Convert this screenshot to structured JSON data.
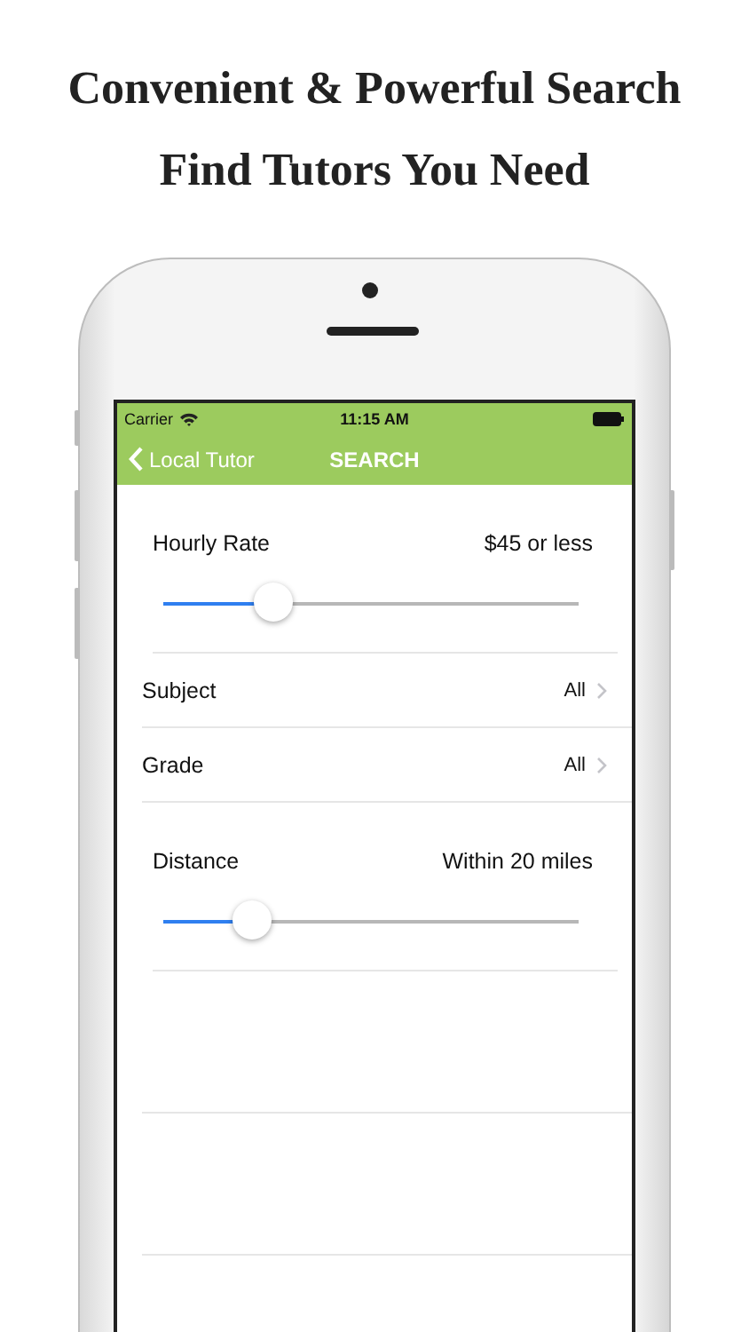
{
  "headline": [
    "Convenient & Powerful Search",
    "Find Tutors You Need"
  ],
  "status_bar": {
    "carrier": "Carrier",
    "time": "11:15 AM"
  },
  "nav_bar": {
    "back": "Local Tutor",
    "title": "SEARCH"
  },
  "rows": [
    {
      "kind": "slider",
      "label": "Hourly Rate",
      "value": "$45 or less",
      "level": 0.27
    },
    {
      "kind": "link",
      "label": "Subject",
      "value": "All"
    },
    {
      "kind": "link",
      "label": "Grade",
      "value": "All"
    },
    {
      "kind": "slider",
      "label": "Distance",
      "value": "Within 20 miles",
      "level": 0.22
    }
  ]
}
